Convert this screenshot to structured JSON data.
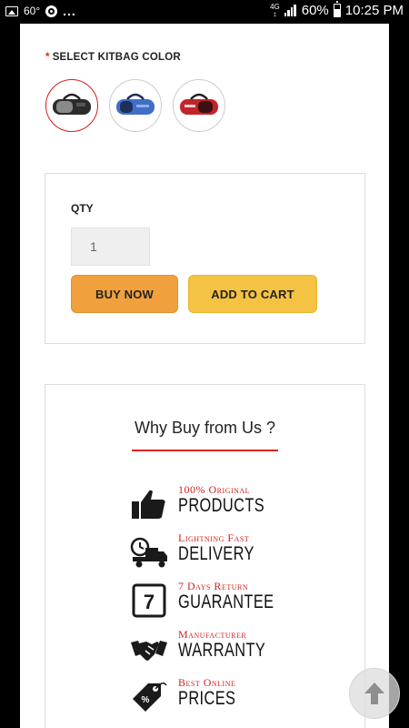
{
  "status_bar": {
    "temperature": "60°",
    "more": "...",
    "network": "4G",
    "battery": "60%",
    "time": "10:25 PM"
  },
  "product": {
    "color_label_required": "*",
    "color_label": "SELECT KITBAG COLOR",
    "swatches": [
      {
        "name": "black-grey kitbag",
        "color": "#2b2b2b",
        "selected": true
      },
      {
        "name": "blue kitbag",
        "color": "#3f6fc6",
        "selected": false
      },
      {
        "name": "red kitbag",
        "color": "#c4232b",
        "selected": false
      }
    ],
    "qty_label": "QTY",
    "qty_value": "1",
    "buy_now_label": "BUY NOW",
    "add_to_cart_label": "ADD TO CART"
  },
  "why_buy": {
    "title": "Why Buy from Us ?",
    "features": [
      {
        "small": "100% Original",
        "big": "PRODUCTS",
        "icon": "thumbs-up-icon"
      },
      {
        "small": "Lightning Fast",
        "big": "DELIVERY",
        "icon": "delivery-truck-icon"
      },
      {
        "small": "7 Days Return",
        "big": "GUARANTEE",
        "icon": "seven-days-icon"
      },
      {
        "small": "Manufacturer",
        "big": "WARRANTY",
        "icon": "handshake-icon"
      },
      {
        "small": "Best Online",
        "big": "PRICES",
        "icon": "price-tag-icon"
      }
    ]
  },
  "scroll_top_icon": "arrow-up-icon",
  "colors": {
    "accent_red": "#e2231a",
    "buy_now": "#f0a13d",
    "add_to_cart": "#f5c343"
  }
}
